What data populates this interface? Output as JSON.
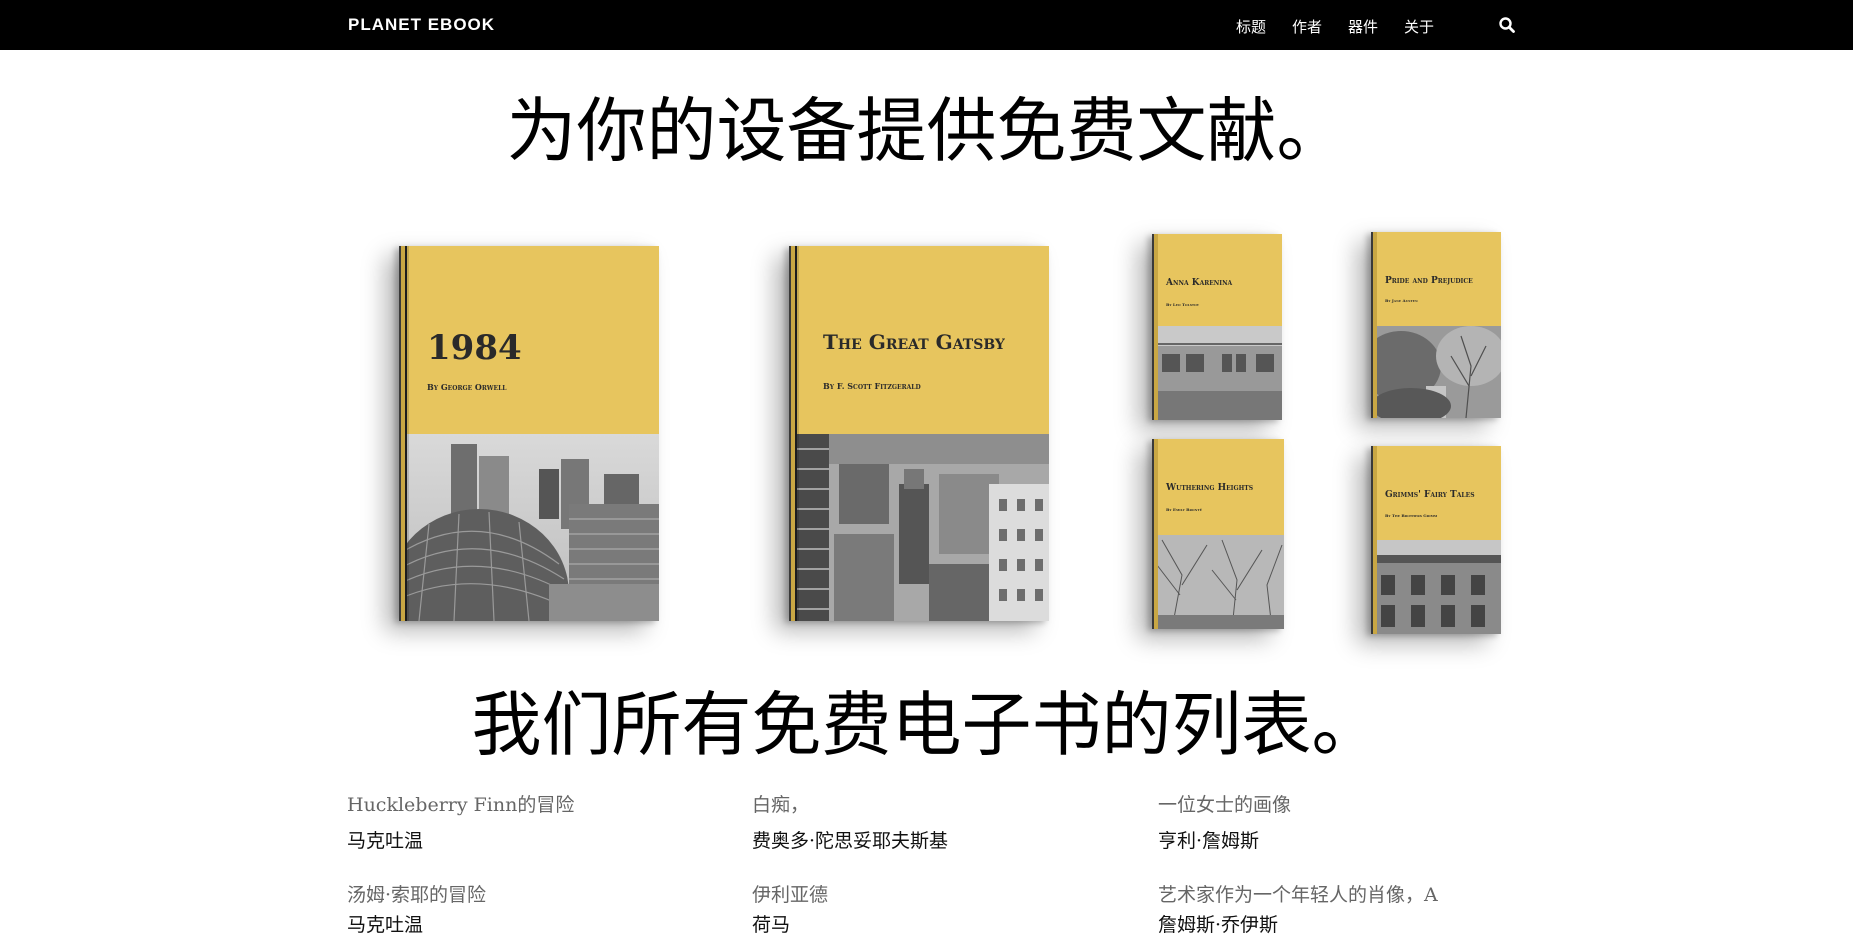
{
  "header": {
    "brand": "PLANET EBOOK",
    "nav": [
      "标题",
      "作者",
      "器件",
      "关于"
    ],
    "search_icon": "search-icon"
  },
  "hero": {
    "title": "为你的设备提供免费文献。"
  },
  "featured_books": [
    {
      "title": "1984",
      "author": "By George Orwell"
    },
    {
      "title": "The Great Gatsby",
      "author": "By F. Scott Fitzgerald"
    },
    {
      "title": "Anna Karenina",
      "author": "By Leo Tolstoy"
    },
    {
      "title": "Pride and Prejudice",
      "author": "By Jane Austen"
    },
    {
      "title": "Wuthering Heights",
      "author": "By Emily Brontë"
    },
    {
      "title": "Grimms' Fairy Tales",
      "author": "By The Brothers Grimm"
    }
  ],
  "book_list": {
    "title": "我们所有免费电子书的列表。",
    "items": [
      {
        "title": "Huckleberry Finn的冒险",
        "author": "马克吐温"
      },
      {
        "title": "白痴，",
        "author": "费奥多·陀思妥耶夫斯基"
      },
      {
        "title": "一位女士的画像",
        "author": "亨利·詹姆斯"
      },
      {
        "title": "汤姆·索耶的冒险",
        "author": "马克吐温"
      },
      {
        "title": "伊利亚德",
        "author": "荷马"
      },
      {
        "title": "艺术家作为一个年轻人的肖像，A",
        "author": "詹姆斯·乔伊斯"
      }
    ]
  },
  "colors": {
    "nav_bg": "#000000",
    "cover_yellow": "#e7c55e"
  }
}
